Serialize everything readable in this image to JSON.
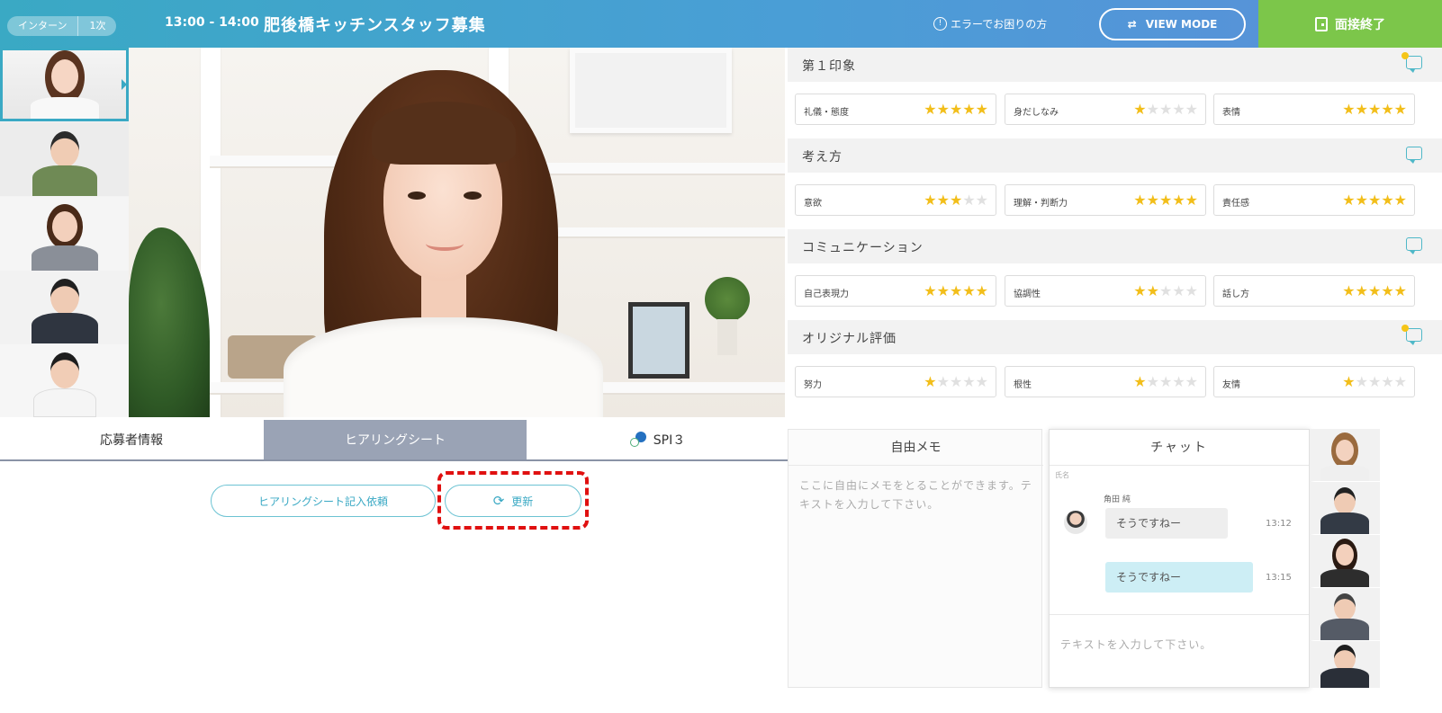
{
  "header": {
    "tag1": "インターン",
    "tag2": "1次",
    "time": "13:00 - 14:00",
    "title": "肥後橋キッチンスタッフ募集",
    "help": "エラーでお困りの方",
    "help_icon": "info-circle-icon",
    "view_mode": "VIEW MODE",
    "end_button": "面接終了",
    "colors": {
      "header_start": "#3aa9c4",
      "header_end": "#5b8fd9",
      "end_button": "#7cc64a"
    }
  },
  "thumbnails": [
    {
      "name": "participant-1",
      "selected": true
    },
    {
      "name": "participant-2",
      "selected": false
    },
    {
      "name": "participant-3",
      "selected": false
    },
    {
      "name": "participant-4",
      "selected": false
    },
    {
      "name": "participant-5",
      "selected": false
    }
  ],
  "evaluation": {
    "categories": [
      {
        "title": "第１印象",
        "comment_flag": true,
        "criteria": [
          {
            "label": "礼儀・態度",
            "stars": 5
          },
          {
            "label": "身だしなみ",
            "stars": 1
          },
          {
            "label": "表情",
            "stars": 5
          }
        ]
      },
      {
        "title": "考え方",
        "comment_flag": false,
        "criteria": [
          {
            "label": "意欲",
            "stars": 3
          },
          {
            "label": "理解・判断力",
            "stars": 5
          },
          {
            "label": "責任感",
            "stars": 5
          }
        ]
      },
      {
        "title": "コミュニケーション",
        "comment_flag": false,
        "criteria": [
          {
            "label": "自己表現力",
            "stars": 5
          },
          {
            "label": "協調性",
            "stars": 2
          },
          {
            "label": "話し方",
            "stars": 5
          }
        ]
      },
      {
        "title": "オリジナル評価",
        "comment_flag": true,
        "criteria": [
          {
            "label": "努力",
            "stars": 1
          },
          {
            "label": "根性",
            "stars": 1
          },
          {
            "label": "友情",
            "stars": 1
          }
        ]
      }
    ],
    "max_stars": 5,
    "star_on_color": "#f2be1a",
    "star_off_color": "#e0e0e0"
  },
  "tabs": {
    "applicant_info": "応募者情報",
    "hearing_sheet": "ヒアリングシート",
    "spi": "SPI３"
  },
  "hearing": {
    "request_button": "ヒアリングシート記入依頼",
    "refresh_button": "更新",
    "refresh_icon": "refresh-icon"
  },
  "memo": {
    "title": "自由メモ",
    "placeholder": "ここに自由にメモをとることができます。テキストを入力して下さい。"
  },
  "chat": {
    "title": "チャット",
    "tiny_label": "氏名",
    "sender": "角田 純",
    "messages": [
      {
        "text": "そうですねー",
        "time": "13:12",
        "type": "received"
      },
      {
        "text": "そうですねー",
        "time": "13:15",
        "type": "sent"
      }
    ],
    "placeholder": "テキストを入力して下さい。"
  }
}
